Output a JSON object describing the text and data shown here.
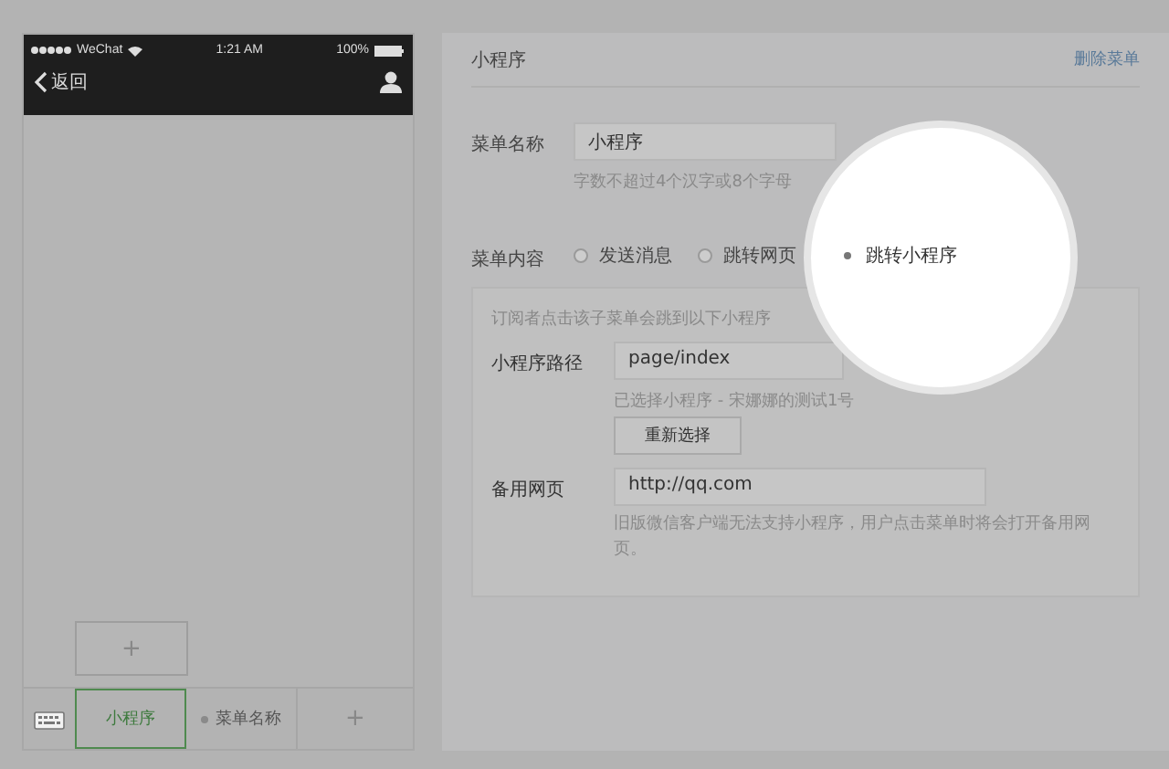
{
  "status_bar": {
    "carrier": "WeChat",
    "time": "1:21 AM",
    "battery": "100%"
  },
  "nav": {
    "back": "返回"
  },
  "submenu": {
    "add": "+"
  },
  "menu_bar": {
    "items": [
      {
        "label": "小程序",
        "selected": true
      },
      {
        "label": "菜单名称",
        "selected": false
      }
    ],
    "add": "+"
  },
  "editor": {
    "title": "小程序",
    "delete": "删除菜单",
    "name_label": "菜单名称",
    "name_value": "小程序",
    "name_hint": "字数不超过4个汉字或8个字母",
    "content_label": "菜单内容",
    "options": [
      {
        "label": "发送消息",
        "selected": false
      },
      {
        "label": "跳转网页",
        "selected": false
      },
      {
        "label": "跳转小程序",
        "selected": true
      }
    ],
    "intro": "订阅者点击该子菜单会跳到以下小程序",
    "path_label": "小程序路径",
    "path_value": "page/index",
    "path_note": "已选择小程序 - 宋娜娜的测试1号",
    "reselect": "重新选择",
    "backup_label": "备用网页",
    "backup_value": "http://qq.com",
    "backup_note": "旧版微信客户端无法支持小程序，用户点击菜单时将会打开备用网页。"
  }
}
